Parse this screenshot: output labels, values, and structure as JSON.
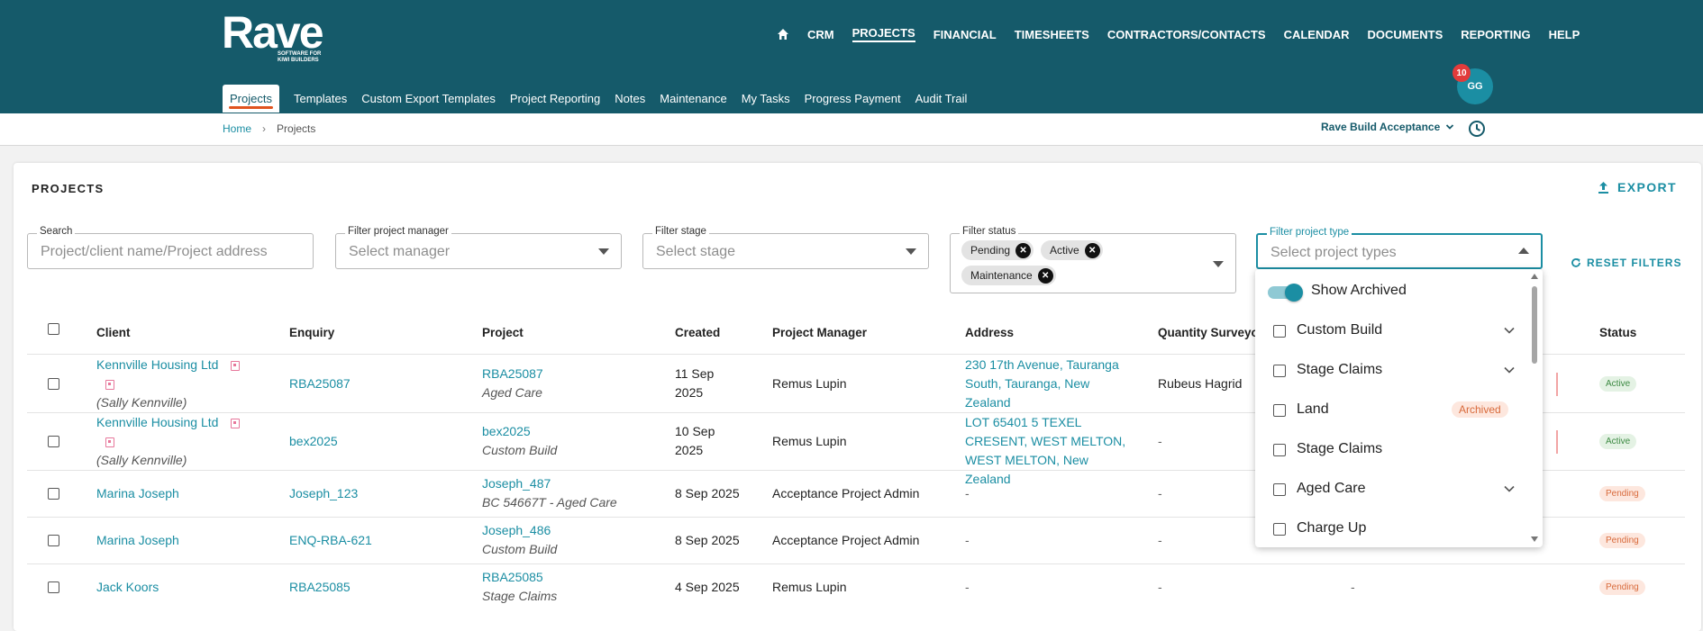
{
  "brand": {
    "name": "Rave",
    "tagline": "SOFTWARE FOR KIWI BUILDERS"
  },
  "main_nav": [
    {
      "label": "CRM",
      "active": false
    },
    {
      "label": "PROJECTS",
      "active": true
    },
    {
      "label": "FINANCIAL",
      "active": false
    },
    {
      "label": "TIMESHEETS",
      "active": false
    },
    {
      "label": "CONTRACTORS/CONTACTS",
      "active": false
    },
    {
      "label": "CALENDAR",
      "active": false
    },
    {
      "label": "DOCUMENTS",
      "active": false
    },
    {
      "label": "REPORTING",
      "active": false
    },
    {
      "label": "HELP",
      "active": false
    }
  ],
  "sub_nav": [
    {
      "label": "Projects",
      "active": true
    },
    {
      "label": "Templates"
    },
    {
      "label": "Custom Export Templates"
    },
    {
      "label": "Project Reporting"
    },
    {
      "label": "Notes"
    },
    {
      "label": "Maintenance"
    },
    {
      "label": "My Tasks"
    },
    {
      "label": "Progress Payment"
    },
    {
      "label": "Audit Trail"
    }
  ],
  "user": {
    "initials": "GG",
    "notifications": "10"
  },
  "breadcrumb": {
    "home": "Home",
    "current": "Projects"
  },
  "org": {
    "name": "Rave Build Acceptance"
  },
  "page": {
    "title": "PROJECTS",
    "export_label": "EXPORT",
    "reset_label": "RESET FILTERS"
  },
  "filters": {
    "search": {
      "label": "Search",
      "placeholder": "Project/client name/Project address"
    },
    "manager": {
      "label": "Filter project manager",
      "placeholder": "Select manager"
    },
    "stage": {
      "label": "Filter stage",
      "placeholder": "Select stage"
    },
    "status": {
      "label": "Filter status",
      "chips": [
        "Pending",
        "Active",
        "Maintenance"
      ]
    },
    "type": {
      "label": "Filter project type",
      "placeholder": "Select project types"
    }
  },
  "table": {
    "headers": [
      "Client",
      "Enquiry",
      "Project",
      "Created",
      "Project Manager",
      "Address",
      "Quantity Surveyor",
      "Status"
    ],
    "rows": [
      {
        "client": "Kennville Housing Ltd",
        "contact": "(Sally Kennville)",
        "enquiry": "RBA25087",
        "project": "RBA25087",
        "project_type": "Aged Care",
        "created": "11 Sep 2025",
        "manager": "Remus Lupin",
        "address": "230 17th Avenue, Tauranga South, Tauranga, New Zealand",
        "qs": "Rubeus Hagrid",
        "status": "Active"
      },
      {
        "client": "Kennville Housing Ltd",
        "contact": "(Sally Kennville)",
        "enquiry": "bex2025",
        "project": "bex2025",
        "project_type": "Custom Build",
        "created": "10 Sep 2025",
        "manager": "Remus Lupin",
        "address": "LOT 65401 5 TEXEL CRESENT, WEST MELTON, WEST MELTON, New Zealand",
        "qs": "-",
        "status": "Active"
      },
      {
        "client": "Marina Joseph",
        "contact": "",
        "enquiry": "Joseph_123",
        "project": "Joseph_487",
        "project_type": "BC 54667T - Aged Care",
        "created": "8 Sep 2025",
        "manager": "Acceptance Project Admin",
        "address": "-",
        "qs": "-",
        "status": "Pending"
      },
      {
        "client": "Marina Joseph",
        "contact": "",
        "enquiry": "ENQ-RBA-621",
        "project": "Joseph_486",
        "project_type": "Custom Build",
        "created": "8 Sep 2025",
        "manager": "Acceptance Project Admin",
        "address": "-",
        "qs": "-",
        "status": "Pending"
      },
      {
        "client": "Jack Koors",
        "contact": "",
        "enquiry": "RBA25085",
        "project": "RBA25085",
        "project_type": "Stage Claims",
        "created": "4 Sep 2025",
        "manager": "Remus Lupin",
        "address": "-",
        "qs": "-",
        "extra": "-",
        "status": "Pending"
      }
    ]
  },
  "project_type_dropdown": {
    "show_archived_label": "Show Archived",
    "show_archived_on": true,
    "options": [
      {
        "label": "Custom Build",
        "expandable": true
      },
      {
        "label": "Stage Claims",
        "expandable": true
      },
      {
        "label": "Land",
        "badge": "Archived"
      },
      {
        "label": "Stage Claims"
      },
      {
        "label": "Aged Care",
        "expandable": true
      },
      {
        "label": "Charge Up"
      }
    ]
  },
  "colors": {
    "header": "#155a6a",
    "accent": "#1b8ea3",
    "underline": "#e0531f",
    "badge": "#e23b3b"
  }
}
